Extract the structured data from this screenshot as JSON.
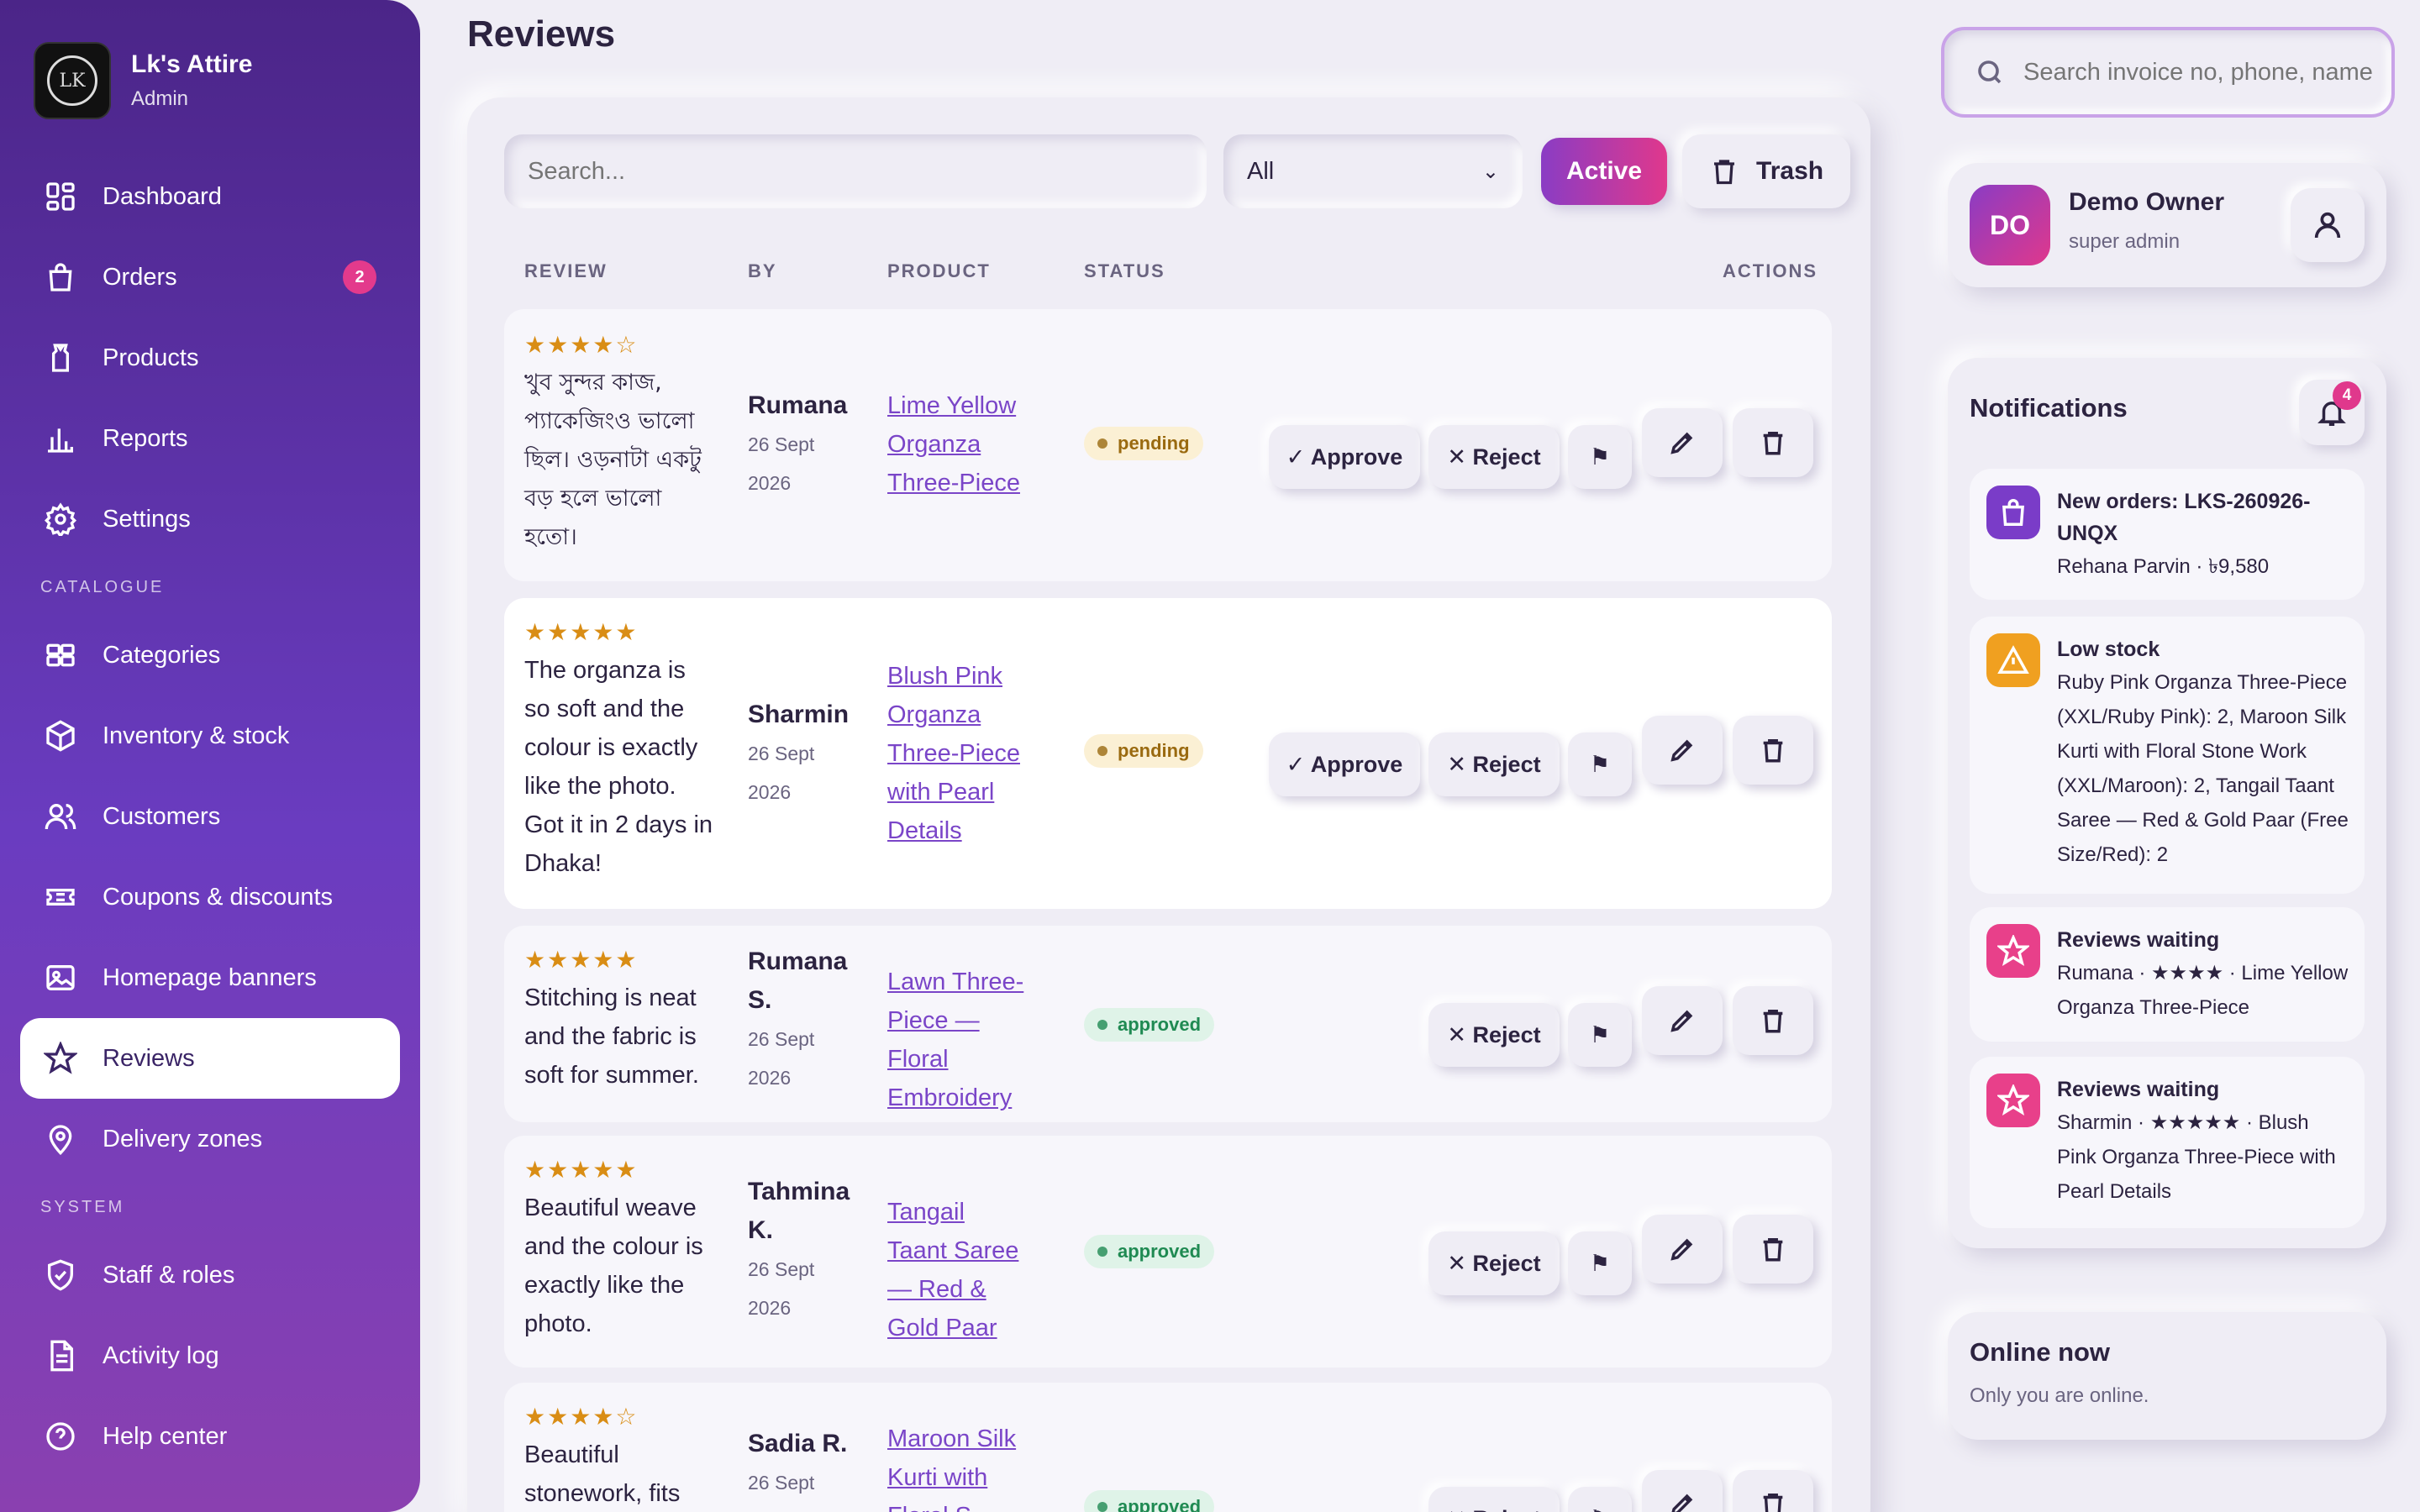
{
  "brand": {
    "name": "Lk's Attire",
    "role": "Admin",
    "logo_text": "LK"
  },
  "nav": {
    "items": [
      {
        "label": "Dashboard",
        "icon": "grid-icon"
      },
      {
        "label": "Orders",
        "icon": "shopping-bag-icon",
        "badge": "2"
      },
      {
        "label": "Products",
        "icon": "shirt-icon"
      },
      {
        "label": "Reports",
        "icon": "bar-chart-icon"
      },
      {
        "label": "Settings",
        "icon": "gear-icon"
      }
    ],
    "section_catalogue": "CATALOGUE",
    "catalogue_items": [
      {
        "label": "Categories",
        "icon": "category-grid-icon"
      },
      {
        "label": "Inventory & stock",
        "icon": "box-icon"
      },
      {
        "label": "Customers",
        "icon": "users-icon"
      },
      {
        "label": "Coupons & discounts",
        "icon": "ticket-icon"
      },
      {
        "label": "Homepage banners",
        "icon": "image-icon"
      },
      {
        "label": "Reviews",
        "icon": "star-icon",
        "active": true
      },
      {
        "label": "Delivery zones",
        "icon": "map-pin-icon"
      }
    ],
    "section_system": "SYSTEM",
    "system_items": [
      {
        "label": "Staff & roles",
        "icon": "shield-check-icon"
      },
      {
        "label": "Activity log",
        "icon": "document-icon"
      },
      {
        "label": "Help center",
        "icon": "help-circle-icon"
      }
    ]
  },
  "page": {
    "title": "Reviews"
  },
  "toolbar": {
    "search_placeholder": "Search...",
    "filter_value": "All",
    "active_label": "Active",
    "trash_label": "Trash"
  },
  "table": {
    "headers": {
      "review": "REVIEW",
      "by": "BY",
      "product": "PRODUCT",
      "status": "STATUS",
      "actions": "ACTIONS"
    },
    "approve_label": "✓ Approve",
    "reject_label": "✕ Reject",
    "flag_glyph": "⚑",
    "rows": [
      {
        "stars": "★★★★☆",
        "text": "খুব সুন্দর কাজ, প্যাকেজিংও ভালো ছিল। ওড়নাটা একটু বড় হলে ভালো হতো।",
        "by": "Rumana",
        "date": "26 Sept 2026",
        "product": "Lime Yellow Organza Three-Piece",
        "status": "pending"
      },
      {
        "stars": "★★★★★",
        "text": "The organza is so soft and the colour is exactly like the photo. Got it in 2 days in Dhaka!",
        "by": "Sharmin",
        "date": "26 Sept 2026",
        "product": "Blush Pink Organza Three-Piece with Pearl Details",
        "status": "pending"
      },
      {
        "stars": "★★★★★",
        "text": "Stitching is neat and the fabric is soft for summer.",
        "by": "Rumana S.",
        "date": "26 Sept 2026",
        "product": "Lawn Three-Piece — Floral Embroidery",
        "status": "approved"
      },
      {
        "stars": "★★★★★",
        "text": "Beautiful weave and the colour is exactly like the photo.",
        "by": "Tahmina K.",
        "date": "26 Sept 2026",
        "product": "Tangail Taant Saree — Red & Gold Paar",
        "status": "approved"
      },
      {
        "stars": "★★★★☆",
        "text": "Beautiful stonework, fits",
        "by": "Sadia R.",
        "date": "26 Sept",
        "product": "Maroon Silk Kurti with Floral S",
        "status": "approved"
      }
    ]
  },
  "top_search": {
    "placeholder": "Search invoice no, phone, name"
  },
  "user": {
    "initials": "DO",
    "name": "Demo Owner",
    "role": "super admin"
  },
  "notifications": {
    "title": "Notifications",
    "count": "4",
    "items": [
      {
        "icon": "shopping-bag-icon",
        "color": "#7a3cc8",
        "head": "New orders: LKS-260926-UNQX",
        "text": "Rehana Parvin · ৳9,580"
      },
      {
        "icon": "warning-icon",
        "color": "#f0a020",
        "head": "Low stock",
        "text": "Ruby Pink Organza Three-Piece (XXL/Ruby Pink): 2, Maroon Silk Kurti with Floral Stone Work (XXL/Maroon): 2, Tangail Taant Saree — Red & Gold Paar (Free Size/Red): 2"
      },
      {
        "icon": "star-icon",
        "color": "#e8408a",
        "head": "Reviews waiting",
        "text": "Rumana · ★★★★ · Lime Yellow Organza Three-Piece"
      },
      {
        "icon": "star-icon",
        "color": "#e8408a",
        "head": "Reviews waiting",
        "text": "Sharmin · ★★★★★ · Blush Pink Organza Three-Piece with Pearl Details"
      }
    ]
  },
  "online": {
    "title": "Online now",
    "subtitle": "Only you are online."
  }
}
